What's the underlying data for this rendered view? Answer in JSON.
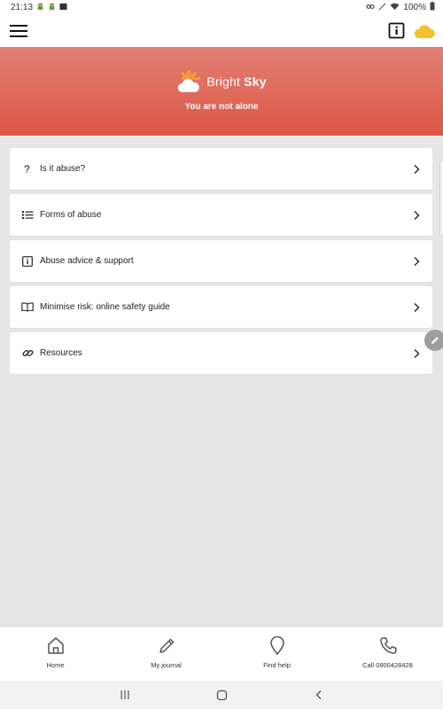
{
  "status_bar": {
    "time": "21:13",
    "battery": "100%"
  },
  "app": {
    "name_part1": "Bright",
    "name_part2": "Sky",
    "tagline": "You are not alone"
  },
  "menu": [
    {
      "icon": "question-icon",
      "label": "Is it abuse?"
    },
    {
      "icon": "list-icon",
      "label": "Forms of abuse"
    },
    {
      "icon": "info-icon",
      "label": "Abuse advice & support"
    },
    {
      "icon": "book-icon",
      "label": "Minimise risk: online safety guide"
    },
    {
      "icon": "link-icon",
      "label": "Resources"
    }
  ],
  "bottom_nav": [
    {
      "icon": "home-icon",
      "label": "Home"
    },
    {
      "icon": "pencil-icon",
      "label": "My journal"
    },
    {
      "icon": "location-pin-icon",
      "label": "Find help"
    },
    {
      "icon": "phone-icon",
      "label": "Call 0800428428"
    }
  ],
  "colors": {
    "accent": "#dc5a4b",
    "cloud": "#f5c12c",
    "background": "#e6e6e6"
  }
}
